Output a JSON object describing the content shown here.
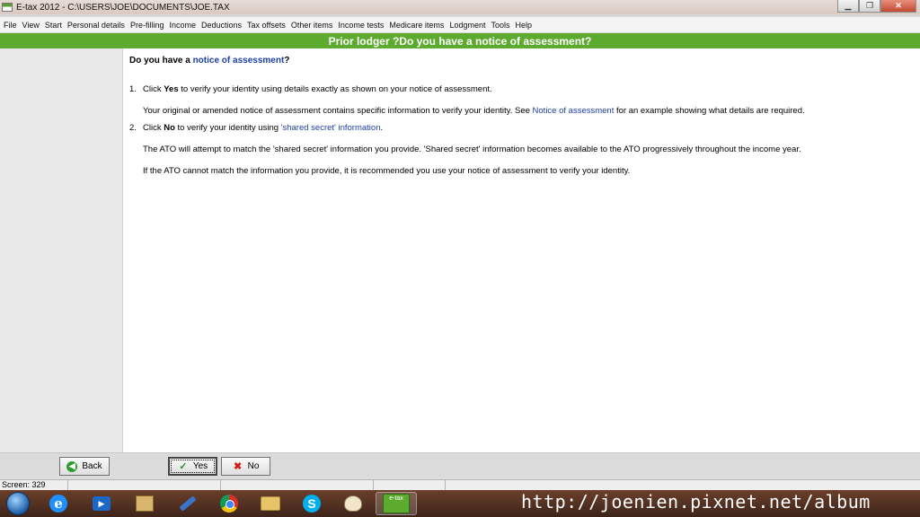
{
  "window": {
    "title": "E-tax 2012 - C:\\USERS\\JOE\\DOCUMENTS\\JOE.TAX",
    "minimize": "▁",
    "maximize": "❐",
    "close": "✕"
  },
  "menu": [
    "File",
    "View",
    "Start",
    "Personal details",
    "Pre-filling",
    "Income",
    "Deductions",
    "Tax offsets",
    "Other items",
    "Income tests",
    "Medicare items",
    "Lodgment",
    "Tools",
    "Help"
  ],
  "header": {
    "title": "Prior lodger ?Do you have a notice of assessment?"
  },
  "content": {
    "question_prefix": "Do you have a ",
    "question_link": "notice of assessment",
    "question_suffix": "?",
    "item1": {
      "number": "1.",
      "pre": "Click ",
      "bold": "Yes",
      "post": " to verify your identity using details exactly as shown on your notice of assessment.",
      "note_pre": "Your original or amended notice of assessment contains specific information to verify your identity. See ",
      "note_link": "Notice of assessment",
      "note_post": " for an example showing what details are required."
    },
    "item2": {
      "number": "2.",
      "pre": "Click ",
      "bold": "No",
      "mid": " to verify your identity using ",
      "link": "'shared secret' information",
      "post": ".",
      "note1": "The ATO will attempt to match the 'shared secret' information you provide. 'Shared secret' information becomes available to the ATO progressively throughout the income year.",
      "note2": "If the ATO cannot match the information you provide, it is recommended you use your notice of assessment to verify your identity."
    }
  },
  "buttons": {
    "back": "Back",
    "yes": "Yes",
    "no": "No"
  },
  "status": {
    "screen": "Screen: 329"
  },
  "taskbar": {
    "etax_label": "e-tax"
  },
  "watermark": "http://joenien.pixnet.net/album",
  "colors": {
    "header_green": "#5dab2e",
    "link_blue": "#1b3fa6"
  }
}
